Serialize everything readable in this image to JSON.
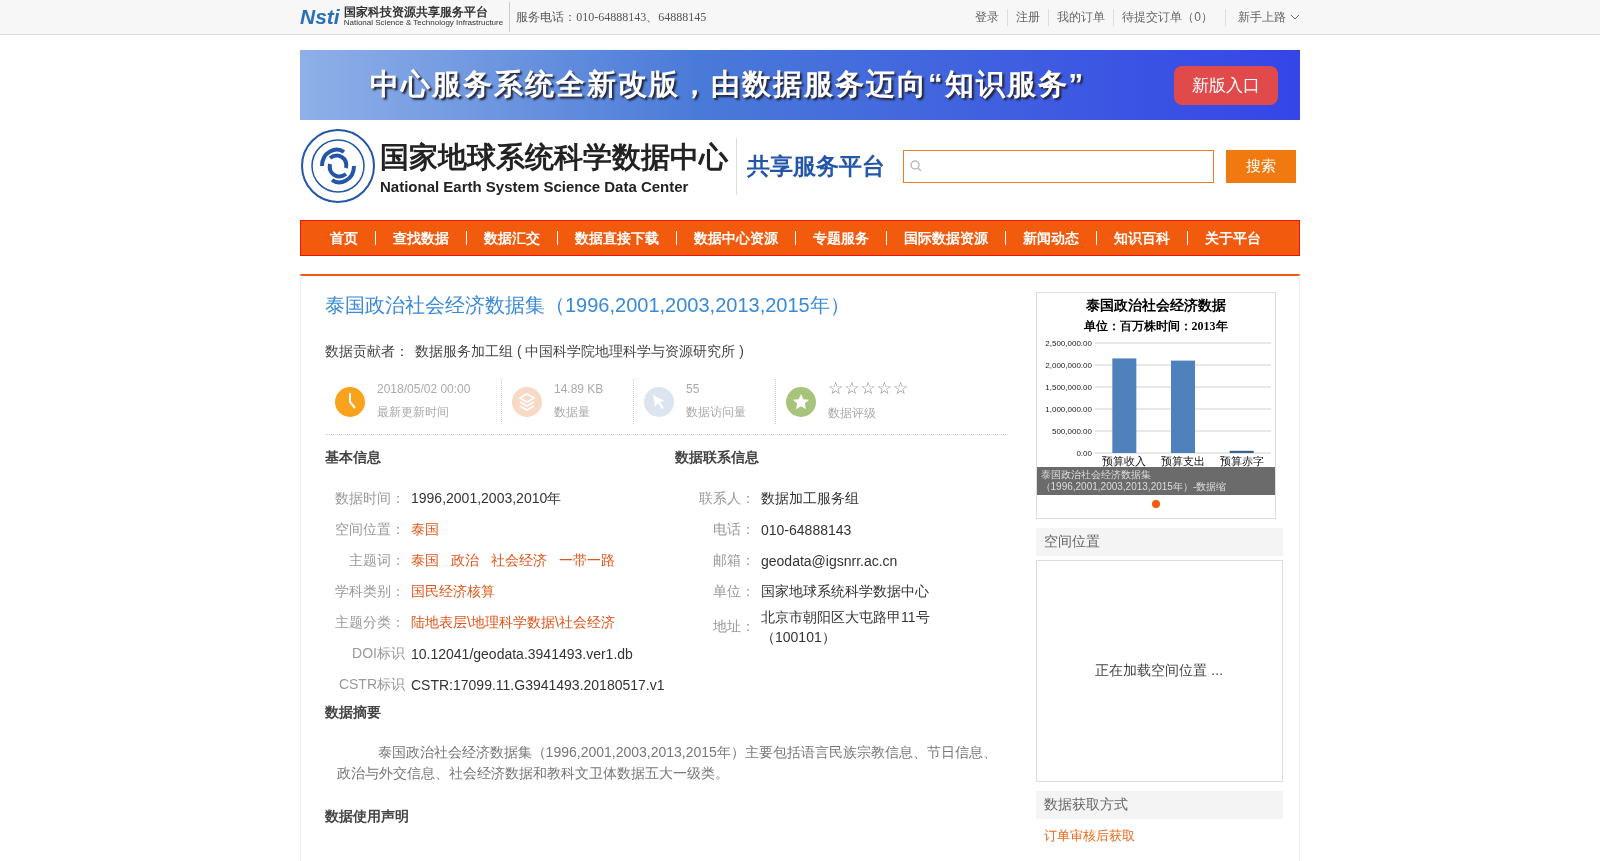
{
  "topbar": {
    "logo_cn": "国家科技资源共享服务平台",
    "logo_en": "National Science & Technology Infrastructure",
    "logo_mark": "Nsti",
    "phone": "服务电话：010-64888143、64888145",
    "links": [
      "登录",
      "注册",
      "我的订单",
      "待提交订单（0）"
    ],
    "guide": "新手上路"
  },
  "banner": {
    "text": "中心服务系统全新改版，由数据服务迈向“知识服务”",
    "button": "新版入口"
  },
  "header": {
    "title_cn": "国家地球系统科学数据中心",
    "title_en": "National Earth System Science Data Center",
    "platform": "共享服务平台",
    "search_button": "搜索"
  },
  "nav": [
    "首页",
    "查找数据",
    "数据汇交",
    "数据直接下载",
    "数据中心资源",
    "专题服务",
    "国际数据资源",
    "新闻动态",
    "知识百科",
    "关于平台"
  ],
  "dataset": {
    "title": "泰国政治社会经济数据集（1996,2001,2003,2013,2015年）",
    "contributor_label": "数据贡献者：",
    "contributor": "数据服务加工组 ( 中国科学院地理科学与资源研究所 )",
    "stats": [
      {
        "kind": "clock",
        "value": "2018/05/02 00:00",
        "label": "最新更新时间"
      },
      {
        "kind": "size",
        "value": "14.89 KB",
        "label": "数据量"
      },
      {
        "kind": "visits",
        "value": "55",
        "label": "数据访问量"
      },
      {
        "kind": "rating",
        "stars": 0,
        "label": "数据评级"
      }
    ],
    "basic_title": "基本信息",
    "basic": [
      {
        "label": "数据时间：",
        "values": [
          "1996,2001,2003,2010年"
        ],
        "kind": "text"
      },
      {
        "label": "空间位置：",
        "values": [
          "泰国"
        ],
        "kind": "link"
      },
      {
        "label": "主题词：",
        "values": [
          "泰国",
          "政治",
          "社会经济",
          "一带一路"
        ],
        "kind": "link"
      },
      {
        "label": "学科类别：",
        "values": [
          "国民经济核算"
        ],
        "kind": "link"
      },
      {
        "label": "主题分类：",
        "values": [
          "陆地表层\\地理科学数据\\社会经济"
        ],
        "kind": "link"
      },
      {
        "label": "DOI标识",
        "values": [
          "10.12041/geodata.3941493.ver1.db"
        ],
        "kind": "text"
      },
      {
        "label": "CSTR标识",
        "values": [
          "CSTR:17099.11.G3941493.20180517.v1"
        ],
        "kind": "text"
      }
    ],
    "contact_title": "数据联系信息",
    "contact": [
      {
        "label": "联系人：",
        "value": "数据加工服务组"
      },
      {
        "label": "电话：",
        "value": "010-64888143"
      },
      {
        "label": "邮箱：",
        "value": "geodata@igsnrr.ac.cn"
      },
      {
        "label": "单位：",
        "value": "国家地球系统科学数据中心"
      },
      {
        "label": "地址：",
        "value": "北京市朝阳区大屯路甲11号（100101）"
      }
    ],
    "abstract_title": "数据摘要",
    "abstract": "泰国政治社会经济数据集（1996,2001,2003,2013,2015年）主要包括语言民族宗教信息、节日信息、政治与外交信息、社会经济数据和教科文卫体数据五大一级类。",
    "usage_title": "数据使用声明"
  },
  "sidebar": {
    "thumbnail": {
      "subtitle": "单位：百万株时间：2013年",
      "caption": "泰国政治社会经济数据集（1996,2001,2003,2013,2015年）-数据缩",
      "slides": [
        {
          "selected": true
        }
      ],
      "chart_data": {
        "type": "bar",
        "grid": true,
        "title": "泰国政治社会经济数据",
        "categories": [
          "预算收入",
          "预算支出",
          "预算赤字"
        ],
        "values": [
          2150000,
          2100000,
          50000
        ],
        "ylim": [
          0,
          2500000
        ],
        "yticks": [
          {
            "value": 0,
            "label": "0.00"
          },
          {
            "value": 500000,
            "label": "500,000.00"
          },
          {
            "value": 1000000,
            "label": "1,000,000.00"
          },
          {
            "value": 1500000,
            "label": "1,500,000.00"
          },
          {
            "value": 2000000,
            "label": "2,000,000.00"
          },
          {
            "value": 2500000,
            "label": "2,500,000.00"
          }
        ]
      }
    },
    "location_title": "空间位置",
    "location_loading": "正在加载空间位置 ...",
    "access_title": "数据获取方式",
    "access": "订单审核后获取"
  }
}
